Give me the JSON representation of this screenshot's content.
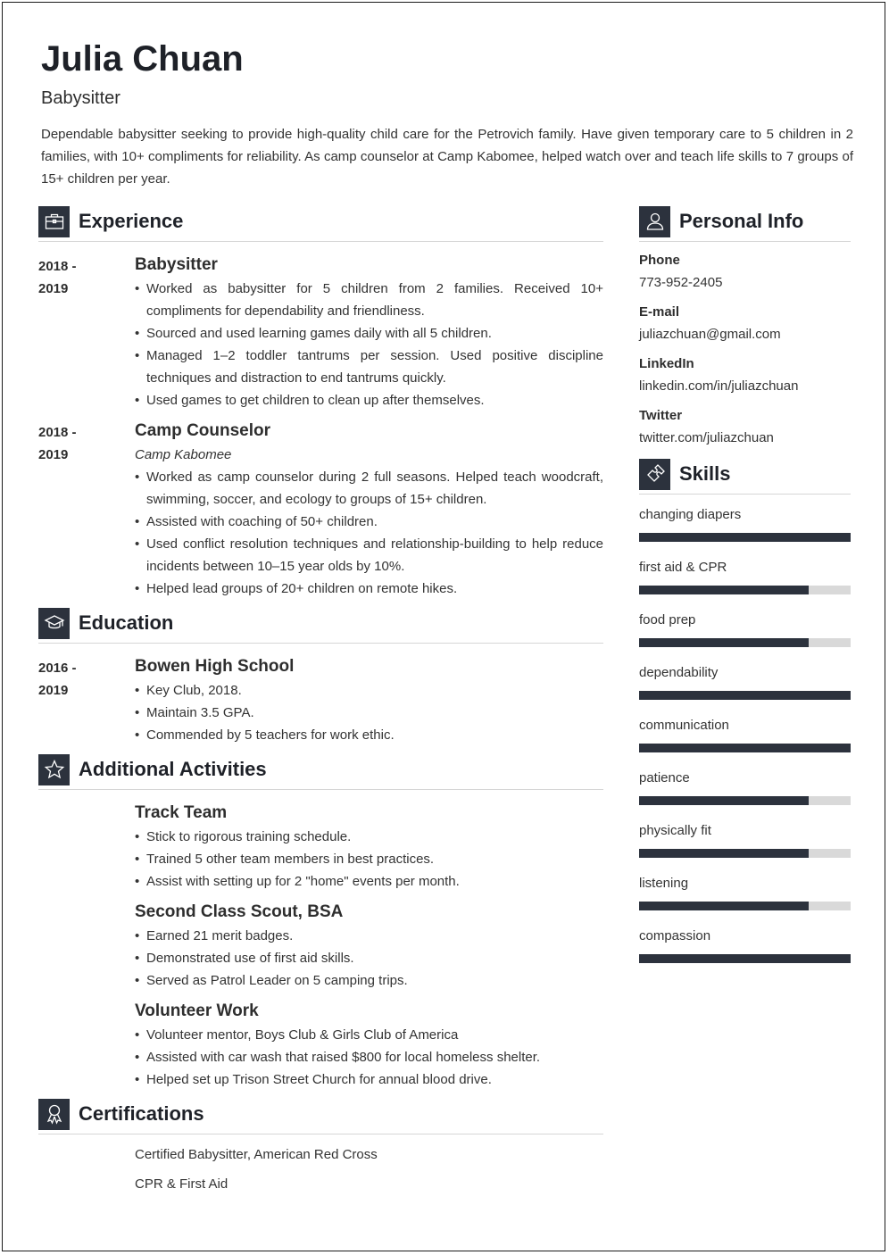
{
  "header": {
    "name": "Julia Chuan",
    "title": "Babysitter",
    "summary": "Dependable babysitter seeking to provide high-quality child care for the Petrovich family. Have given temporary care to 5 children in 2 families, with 10+ compliments for reliability. As camp counselor at Camp Kabomee, helped watch over and teach life skills to 7 groups of 15+ children per year."
  },
  "experience": {
    "heading": "Experience",
    "icon": "briefcase-icon",
    "entries": [
      {
        "date_start": "2018 -",
        "date_end": "2019",
        "title": "Babysitter",
        "subtitle": "",
        "bullets": [
          "Worked as babysitter for 5 children from 2 families. Received 10+ compliments for dependability and friendliness.",
          "Sourced and used learning games daily with all 5 children.",
          "Managed 1–2 toddler tantrums per session. Used positive discipline techniques and distraction to end tantrums quickly.",
          "Used games to get children to clean up after themselves."
        ]
      },
      {
        "date_start": "2018 -",
        "date_end": "2019",
        "title": "Camp Counselor",
        "subtitle": "Camp Kabomee",
        "bullets": [
          "Worked as camp counselor during 2 full seasons. Helped teach woodcraft, swimming, soccer, and ecology to groups of 15+ children.",
          "Assisted with coaching of 50+ children.",
          "Used conflict resolution techniques and relationship-building to help reduce incidents between 10–15 year olds by 10%.",
          "Helped lead groups of 20+ children on remote hikes."
        ]
      }
    ]
  },
  "education": {
    "heading": "Education",
    "icon": "graduation-cap-icon",
    "entries": [
      {
        "date_start": "2016 -",
        "date_end": "2019",
        "title": "Bowen High School",
        "bullets": [
          "Key Club, 2018.",
          "Maintain 3.5 GPA.",
          "Commended by 5 teachers for work ethic."
        ]
      }
    ]
  },
  "activities": {
    "heading": "Additional Activities",
    "icon": "star-icon",
    "entries": [
      {
        "title": "Track Team",
        "bullets": [
          "Stick to rigorous training schedule.",
          "Trained 5 other team members in best practices.",
          "Assist with setting up for 2 \"home\" events per month."
        ]
      },
      {
        "title": "Second Class Scout, BSA",
        "bullets": [
          "Earned 21 merit badges.",
          "Demonstrated use of first aid skills.",
          "Served as Patrol Leader on 5 camping trips."
        ]
      },
      {
        "title": "Volunteer Work",
        "bullets": [
          "Volunteer mentor, Boys Club & Girls Club of America",
          "Assisted with car wash that raised $800 for local homeless shelter.",
          "Helped set up Trison Street Church for annual blood drive."
        ]
      }
    ]
  },
  "certifications": {
    "heading": "Certifications",
    "icon": "award-ribbon-icon",
    "items": [
      "Certified Babysitter, American Red Cross",
      "CPR & First Aid"
    ]
  },
  "personal_info": {
    "heading": "Personal Info",
    "icon": "user-icon",
    "fields": [
      {
        "label": "Phone",
        "value": "773-952-2405"
      },
      {
        "label": "E-mail",
        "value": "juliazchuan@gmail.com"
      },
      {
        "label": "LinkedIn",
        "value": "linkedin.com/in/juliazchuan"
      },
      {
        "label": "Twitter",
        "value": "twitter.com/juliazchuan"
      }
    ]
  },
  "skills": {
    "heading": "Skills",
    "icon": "puzzle-piece-icon",
    "bar_color": "#2c323d",
    "track_color": "#d9d9d9",
    "items": [
      {
        "name": "changing diapers",
        "level": 1.0
      },
      {
        "name": "first aid & CPR",
        "level": 0.8
      },
      {
        "name": "food prep",
        "level": 0.8
      },
      {
        "name": "dependability",
        "level": 1.0
      },
      {
        "name": "communication",
        "level": 1.0
      },
      {
        "name": "patience",
        "level": 0.8
      },
      {
        "name": "physically fit",
        "level": 0.8
      },
      {
        "name": "listening",
        "level": 0.8
      },
      {
        "name": "compassion",
        "level": 1.0
      }
    ]
  }
}
